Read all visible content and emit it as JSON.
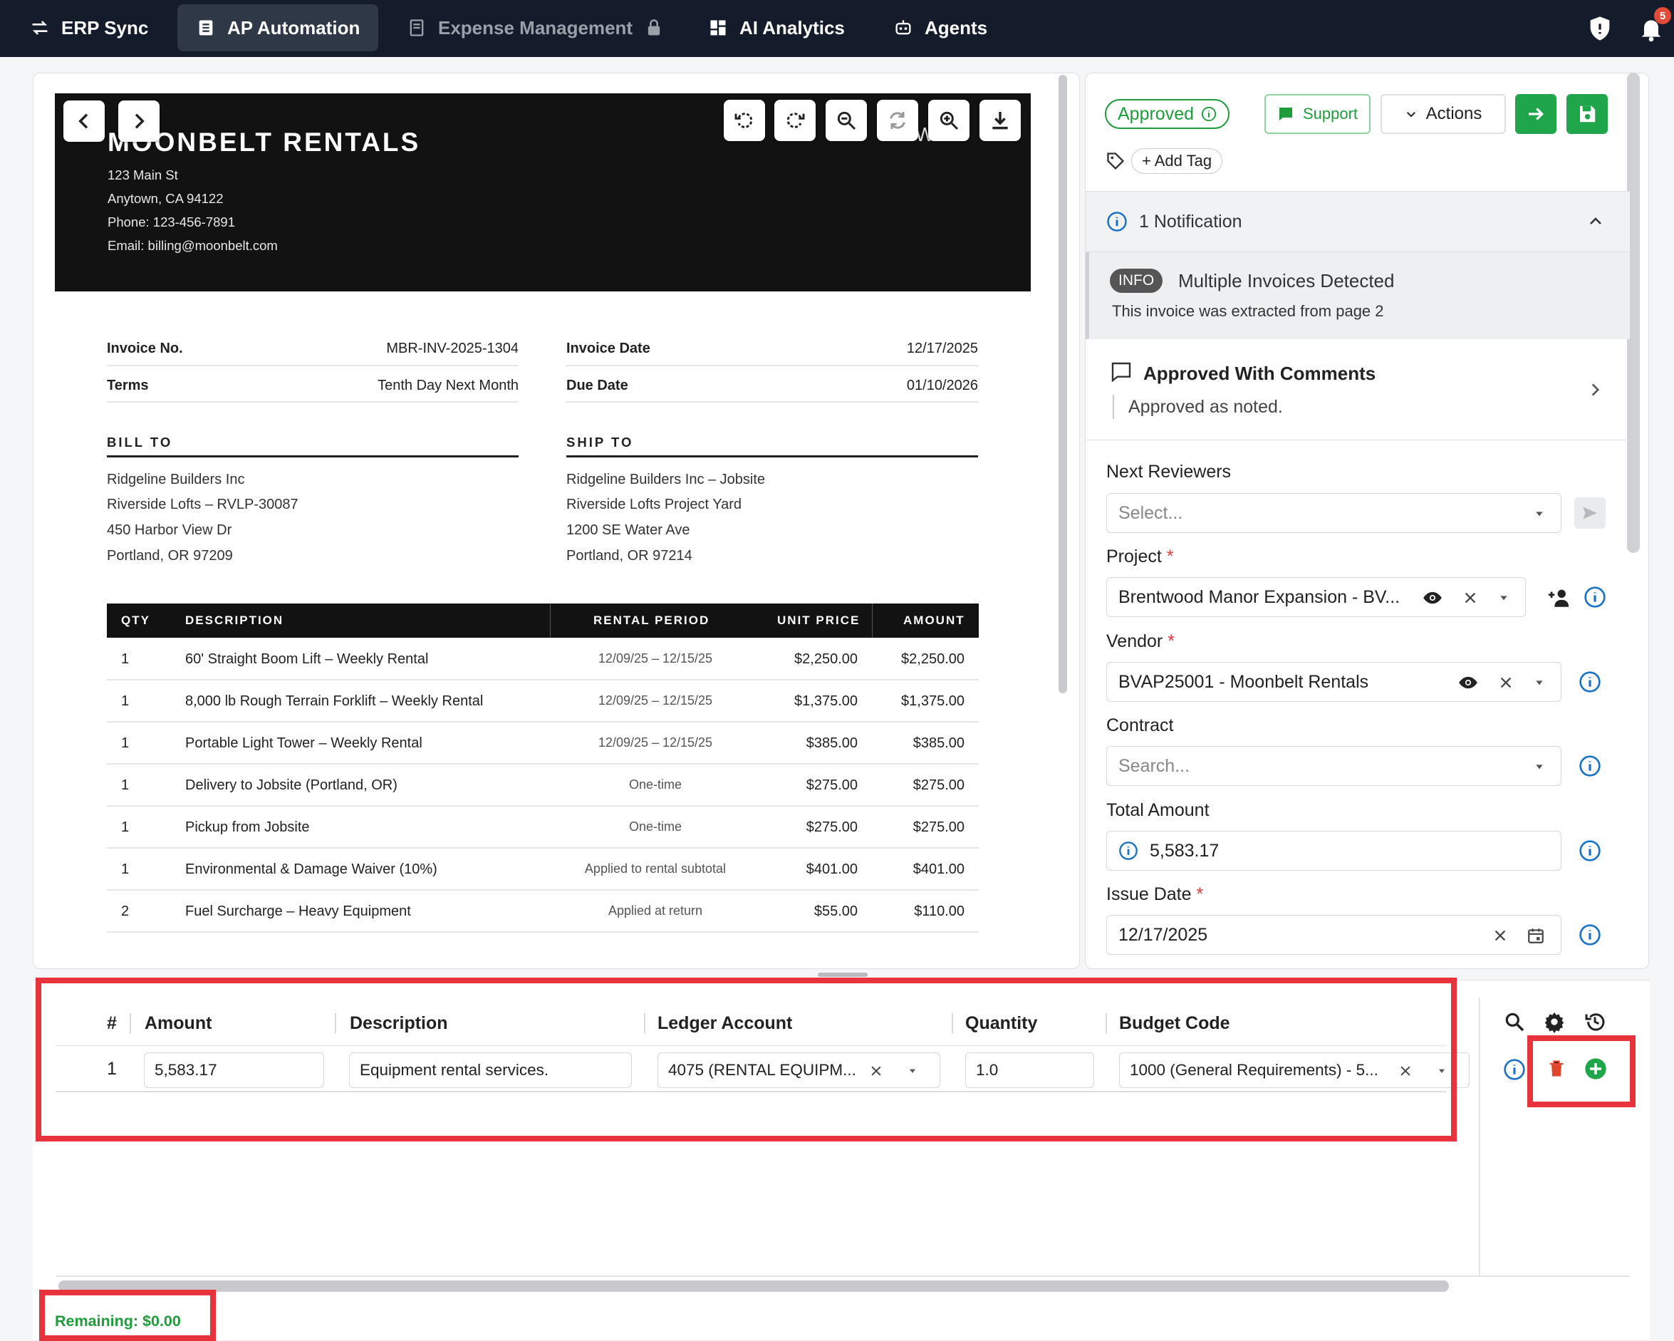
{
  "nav": {
    "tabs": [
      {
        "label": "ERP Sync",
        "icon": "sync-arrows-icon"
      },
      {
        "label": "AP Automation",
        "icon": "document-icon"
      },
      {
        "label": "Expense Management",
        "icon": "receipt-icon",
        "locked": true
      },
      {
        "label": "AI Analytics",
        "icon": "dashboard-icon"
      },
      {
        "label": "Agents",
        "icon": "robot-icon"
      }
    ],
    "notification_count": "5"
  },
  "invoice": {
    "vendor_name": "MOONBELT RENTALS",
    "header_partial_text": "W E",
    "address_lines": [
      "123 Main St",
      "Anytown, CA 94122",
      "Phone: 123-456-7891",
      "Email: billing@moonbelt.com"
    ],
    "meta": {
      "invoice_no_label": "Invoice No.",
      "invoice_no": "MBR-INV-2025-1304",
      "terms_label": "Terms",
      "terms": "Tenth Day Next Month",
      "invoice_date_label": "Invoice Date",
      "invoice_date": "12/17/2025",
      "due_date_label": "Due Date",
      "due_date": "01/10/2026"
    },
    "bill_to": {
      "heading": "BILL TO",
      "lines": [
        "Ridgeline Builders Inc",
        "Riverside Lofts – RVLP-30087",
        "450 Harbor View Dr",
        "Portland, OR 97209"
      ]
    },
    "ship_to": {
      "heading": "SHIP TO",
      "lines": [
        "Ridgeline Builders Inc – Jobsite",
        "Riverside Lofts Project Yard",
        "1200 SE Water Ave",
        "Portland, OR 97214"
      ]
    },
    "columns": [
      "QTY",
      "DESCRIPTION",
      "RENTAL PERIOD",
      "UNIT PRICE",
      "AMOUNT"
    ],
    "items": [
      {
        "qty": "1",
        "description": "60' Straight Boom Lift – Weekly Rental",
        "period": "12/09/25 – 12/15/25",
        "unit_price": "$2,250.00",
        "amount": "$2,250.00"
      },
      {
        "qty": "1",
        "description": "8,000 lb Rough Terrain Forklift – Weekly Rental",
        "period": "12/09/25 – 12/15/25",
        "unit_price": "$1,375.00",
        "amount": "$1,375.00"
      },
      {
        "qty": "1",
        "description": "Portable Light Tower – Weekly Rental",
        "period": "12/09/25 – 12/15/25",
        "unit_price": "$385.00",
        "amount": "$385.00"
      },
      {
        "qty": "1",
        "description": "Delivery to Jobsite (Portland, OR)",
        "period": "One-time",
        "unit_price": "$275.00",
        "amount": "$275.00"
      },
      {
        "qty": "1",
        "description": "Pickup from Jobsite",
        "period": "One-time",
        "unit_price": "$275.00",
        "amount": "$275.00"
      },
      {
        "qty": "1",
        "description": "Environmental & Damage Waiver (10%)",
        "period": "Applied to rental subtotal",
        "unit_price": "$401.00",
        "amount": "$401.00"
      },
      {
        "qty": "2",
        "description": "Fuel Surcharge – Heavy Equipment",
        "period": "Applied at return",
        "unit_price": "$55.00",
        "amount": "$110.00"
      }
    ]
  },
  "viewer_toolbar": [
    "rotate-left-icon",
    "rotate-right-icon",
    "zoom-out-icon",
    "refresh-icon",
    "zoom-in-icon",
    "download-icon"
  ],
  "side": {
    "status": "Approved",
    "support_label": "Support",
    "actions_label": "Actions",
    "add_tag_label": "+ Add Tag",
    "notification_header": "1 Notification",
    "info_chip": "INFO",
    "notif_title": "Multiple Invoices Detected",
    "notif_body": "This invoice was extracted from page 2",
    "comment_title": "Approved With Comments",
    "comment_body": "Approved as noted.",
    "next_reviewers_label": "Next Reviewers",
    "reviewers_placeholder": "Select...",
    "project_label": "Project",
    "project_value": "Brentwood Manor Expansion - BV...",
    "vendor_label": "Vendor",
    "vendor_value": "BVAP25001 - Moonbelt Rentals",
    "contract_label": "Contract",
    "contract_placeholder": "Search...",
    "total_label": "Total Amount",
    "total_value": "5,583.17",
    "issue_date_label": "Issue Date",
    "issue_date_value": "12/17/2025"
  },
  "grid": {
    "headers": [
      "#",
      "Amount",
      "Description",
      "Ledger Account",
      "Quantity",
      "Budget Code"
    ],
    "row": {
      "num": "1",
      "amount": "5,583.17",
      "description": "Equipment rental services.",
      "ledger": "4075 (RENTAL EQUIPM...",
      "quantity": "1.0",
      "budget": "1000 (General Requirements) - 5..."
    },
    "remaining": "Remaining: $0.00"
  },
  "colors": {
    "nav_bg": "#141c2b",
    "accent_green": "#1fa54a",
    "info_blue": "#1a73c7",
    "highlight_red": "#e8323c",
    "delete_red": "#e0462c"
  }
}
